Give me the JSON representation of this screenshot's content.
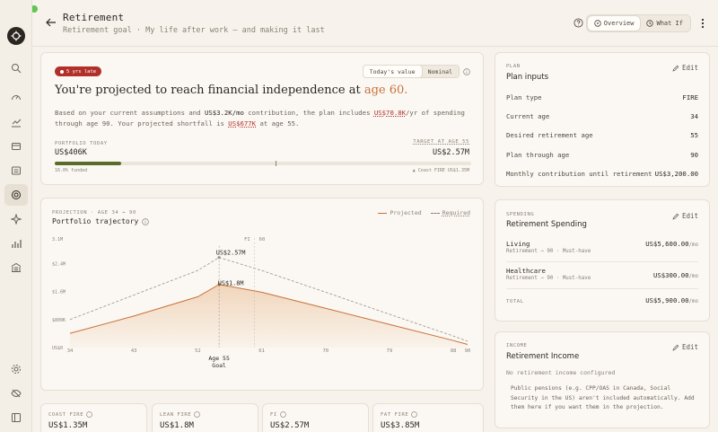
{
  "window": {
    "dots": [
      "#ee6a5f",
      "#f5bd4f",
      "#61c454"
    ]
  },
  "sidebar": {
    "items": [
      {
        "name": "search-icon"
      },
      {
        "name": "gauge-icon"
      },
      {
        "name": "chart-icon"
      },
      {
        "name": "wallet-icon"
      },
      {
        "name": "list-icon"
      },
      {
        "name": "target-icon"
      },
      {
        "name": "sparkle-icon"
      },
      {
        "name": "bar-chart-icon"
      },
      {
        "name": "bank-icon"
      },
      {
        "name": "settings-icon"
      },
      {
        "name": "eye-off-icon"
      },
      {
        "name": "panel-icon"
      }
    ]
  },
  "header": {
    "title": "Retirement",
    "subtitle": "Retirement goal · My life after work — and making it last",
    "tabs": [
      {
        "label": "Overview",
        "active": true
      },
      {
        "label": "What If",
        "active": false
      }
    ]
  },
  "hero": {
    "badge": "5 yrs late",
    "toggle": [
      {
        "label": "Today's value",
        "active": true
      },
      {
        "label": "Nominal",
        "active": false
      }
    ],
    "headline_prefix": "You're projected to reach financial independence at ",
    "headline_accent": "age 60.",
    "para": {
      "p1": "Based on your current assumptions and ",
      "p2": "US$3.2K/mo",
      "p3": " contribution, the plan includes ",
      "p4": "US$70.8K",
      "p5": "/yr of spending through age 90. Your projected shortfall is ",
      "p6": "US$677K",
      "p7": " at age 55."
    },
    "portfolio_label": "PORTFOLIO TODAY",
    "portfolio_value": "US$406K",
    "target_label": "TARGET AT AGE 55",
    "target_value": "US$2.57M",
    "progress_fraction": 0.16,
    "marker_fraction": 0.53,
    "funded_label": "16.0% funded",
    "coast_label": "▲ Coast FIRE US$1.35M"
  },
  "projection": {
    "kicker": "PROJECTION · AGE 34 → 90",
    "title": "Portfolio trajectory",
    "legend_projected": "Projected",
    "legend_required": "Required",
    "fi_label": "FI · 60",
    "peak_label": "US$2.57M",
    "current_label": "US$1.8M",
    "goal_age": "Age 55",
    "goal_word": "Goal"
  },
  "chart_data": {
    "type": "area",
    "x": [
      34,
      43,
      52,
      55,
      61,
      70,
      79,
      88,
      90
    ],
    "x_ticks": [
      "34",
      "43",
      "52",
      "61",
      "70",
      "79",
      "88",
      "90"
    ],
    "y_ticks": [
      "US$0",
      "$800K",
      "$1.6M",
      "$2.4M",
      "3.1M"
    ],
    "ylim": [
      0,
      3100000
    ],
    "series": [
      {
        "name": "Projected",
        "values": [
          406000,
          900000,
          1450000,
          1800000,
          1580000,
          1120000,
          660000,
          200000,
          90000
        ]
      },
      {
        "name": "Required",
        "values": [
          800000,
          1500000,
          2200000,
          2570000,
          2200000,
          1580000,
          950000,
          330000,
          180000
        ]
      }
    ],
    "grid": false,
    "legend": "top-right"
  },
  "stats": [
    {
      "label": "COAST FIRE",
      "value": "US$1.35M"
    },
    {
      "label": "LEAN FIRE",
      "value": "US$1.8M"
    },
    {
      "label": "FI",
      "value": "US$2.57M"
    },
    {
      "label": "FAT FIRE",
      "value": "US$3.85M"
    }
  ],
  "plan": {
    "kicker": "PLAN",
    "title": "Plan inputs",
    "edit": "Edit",
    "rows": [
      {
        "label": "Plan type",
        "value": "FIRE"
      },
      {
        "label": "Current age",
        "value": "34"
      },
      {
        "label": "Desired retirement age",
        "value": "55"
      },
      {
        "label": "Plan through age",
        "value": "90"
      },
      {
        "label": "Monthly contribution until retirement",
        "value": "US$3,200.00"
      }
    ]
  },
  "spending": {
    "kicker": "SPENDING",
    "title": "Retirement Spending",
    "edit": "Edit",
    "items": [
      {
        "name": "Living",
        "meta": "Retirement → 90 · Must-have",
        "value": "US$5,600.00",
        "unit": "/mo"
      },
      {
        "name": "Healthcare",
        "meta": "Retirement → 90 · Must-have",
        "value": "US$300.00",
        "unit": "/mo"
      }
    ],
    "total_label": "TOTAL",
    "total_value": "US$5,900.00",
    "total_unit": "/mo"
  },
  "income": {
    "kicker": "INCOME",
    "title": "Retirement Income",
    "edit": "Edit",
    "empty": "No retirement income configured",
    "note": "Public pensions (e.g. CPP/OAS in Canada, Social Security in the US) aren't included automatically. Add them here if you want them in the projection."
  },
  "colors": {
    "accent": "#c9713a",
    "danger": "#b2302a",
    "progress": "#5a6b2a"
  }
}
